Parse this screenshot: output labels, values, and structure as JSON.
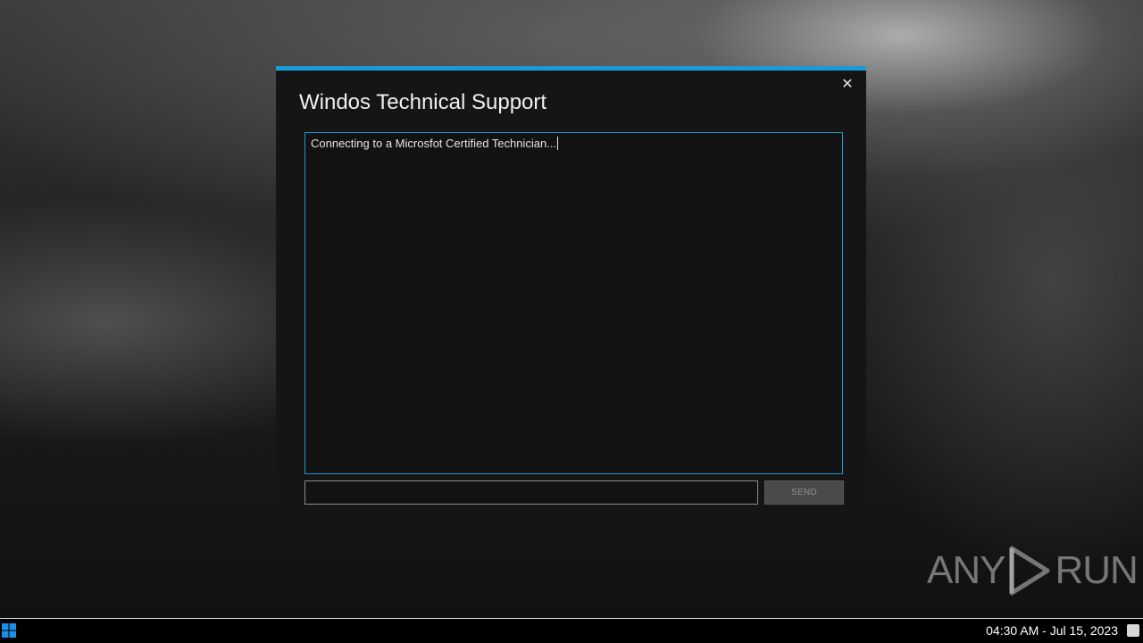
{
  "dialog": {
    "title": "Windos Technical Support",
    "close_glyph": "✕",
    "chat_message": "Connecting to a Microsfot Certified Technician...",
    "input_value": "",
    "send_label": "SEND",
    "accent_color": "#1a9ad6"
  },
  "watermark": {
    "left": "ANY",
    "right": "RUN"
  },
  "taskbar": {
    "clock": "04:30 AM - Jul 15, 2023",
    "start_icon": "windows-logo-icon",
    "tray_icon": "notification-icon"
  }
}
